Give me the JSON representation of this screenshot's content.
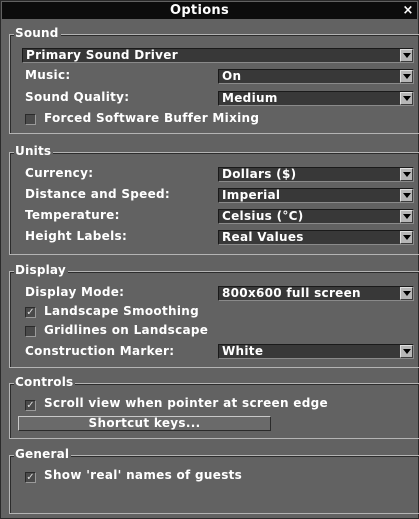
{
  "window": {
    "title": "Options",
    "close_glyph": "×"
  },
  "sound": {
    "title": "Sound",
    "driver": "Primary Sound Driver",
    "music_label": "Music:",
    "music_value": "On",
    "quality_label": "Sound Quality:",
    "quality_value": "Medium",
    "forced_label": "Forced Software Buffer Mixing",
    "forced_checked": false
  },
  "units": {
    "title": "Units",
    "currency_label": "Currency:",
    "currency_value": "Dollars ($)",
    "distance_label": "Distance and Speed:",
    "distance_value": "Imperial",
    "temperature_label": "Temperature:",
    "temperature_value": "Celsius (°C)",
    "height_label": "Height Labels:",
    "height_value": "Real Values"
  },
  "display": {
    "title": "Display",
    "mode_label": "Display Mode:",
    "mode_value": "800x600 full screen",
    "landscape_label": "Landscape Smoothing",
    "landscape_checked": true,
    "gridlines_label": "Gridlines on Landscape",
    "gridlines_checked": false,
    "marker_label": "Construction Marker:",
    "marker_value": "White"
  },
  "controls": {
    "title": "Controls",
    "scroll_label": "Scroll view when pointer at screen edge",
    "scroll_checked": true,
    "shortcut_label": "Shortcut keys..."
  },
  "general": {
    "title": "General",
    "realnames_label": "Show 'real' names of guests",
    "realnames_checked": true
  },
  "icons": {
    "check": "✓",
    "dropdown": "dropdown-arrow-icon",
    "close": "close-icon"
  },
  "colors": {
    "window_bg": "#626262",
    "titlebar_bg": "#0c0c0c",
    "text": "#ffffff",
    "field_bg": "#383838"
  }
}
